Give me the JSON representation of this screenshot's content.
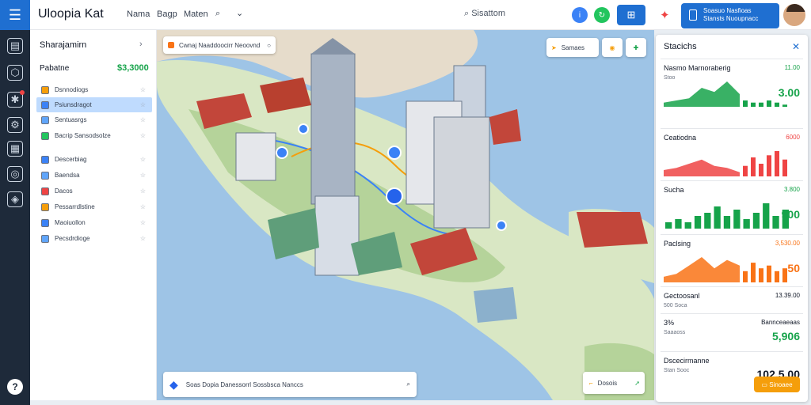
{
  "app": {
    "title": "Uloopia Kat"
  },
  "topbar": {
    "nav": [
      "Nama",
      "Bagp",
      "Maten"
    ],
    "search_text": "Sisattom",
    "account_line1": "Soasuo Nasfioas",
    "account_line2": "Stansts Nuoupnacc"
  },
  "left_panel": {
    "title": "Sharajamirn",
    "section_label": "Pabatne",
    "section_value": "$3,3000",
    "items": [
      {
        "label": "Dsnnodiogs",
        "icon_color": "#f59e0b"
      },
      {
        "label": "Psiunsdragot",
        "icon_color": "#3b82f6"
      },
      {
        "label": "Sentuasrgs",
        "icon_color": "#60a5fa"
      },
      {
        "label": "Bacrip Sansodsolze",
        "icon_color": "#22c55e"
      },
      {
        "label": "Descerbiag",
        "icon_color": "#3b82f6"
      },
      {
        "label": "Baendsa",
        "icon_color": "#60a5fa"
      },
      {
        "label": "Dacos",
        "icon_color": "#ef4444"
      },
      {
        "label": "Pessarrdlstine",
        "icon_color": "#f59e0b"
      },
      {
        "label": "Maoiuollon",
        "icon_color": "#3b82f6"
      },
      {
        "label": "Pecsdrdioge",
        "icon_color": "#60a5fa"
      }
    ]
  },
  "map": {
    "top_chip": "Cwnaj Naaddoocirr Neoovnd",
    "right_chip": "Samaes",
    "bottom_search": "Soas Dopia Danessorrl Sossbsca Nanccs",
    "locate_chip": "Dosois"
  },
  "stats_panel": {
    "title": "Stacichs",
    "cards": [
      {
        "label": "Nasmo Marnoraberig",
        "sub": "Stoo",
        "small_value": "11.00",
        "value": "3.00",
        "color": "#16a34a",
        "series": [
          2,
          3,
          4,
          9,
          7,
          12,
          6,
          3,
          2,
          2,
          3,
          2,
          1
        ]
      },
      {
        "label": "Ceatiodna",
        "sub": "",
        "small_value": "6000",
        "value": "",
        "color": "#ef4444",
        "series": [
          3,
          4,
          6,
          8,
          5,
          4,
          2,
          5,
          9,
          6,
          10,
          12,
          8
        ]
      },
      {
        "label": "Sucha",
        "sub": "",
        "small_value": "3.800",
        "value": "900",
        "color": "#16a34a",
        "series": [
          2,
          3,
          2,
          4,
          5,
          7,
          4,
          6,
          3,
          5,
          8,
          4,
          6
        ]
      },
      {
        "label": "Paclsing",
        "sub": "",
        "small_value": "3,530.00",
        "value": "50",
        "color": "#f97316",
        "series": [
          2,
          3,
          6,
          9,
          5,
          8,
          6,
          4,
          7,
          5,
          6,
          4,
          5
        ]
      },
      {
        "label": "Gectoosanl",
        "sub": "500 Soca",
        "small_value": "13.39.00",
        "value": "",
        "color": "#16a34a",
        "series": []
      },
      {
        "label": "3%",
        "sub": "Saaaoss",
        "small_value": "Bannceaeaas",
        "value": "5,906",
        "color": "#16a34a",
        "series": []
      },
      {
        "label": "Dscecirmanne",
        "sub": "Stan Sooc",
        "small_value": "",
        "value": "102.5.00",
        "color": "#111827",
        "series": []
      }
    ],
    "footer_button": "Sinoaee"
  }
}
